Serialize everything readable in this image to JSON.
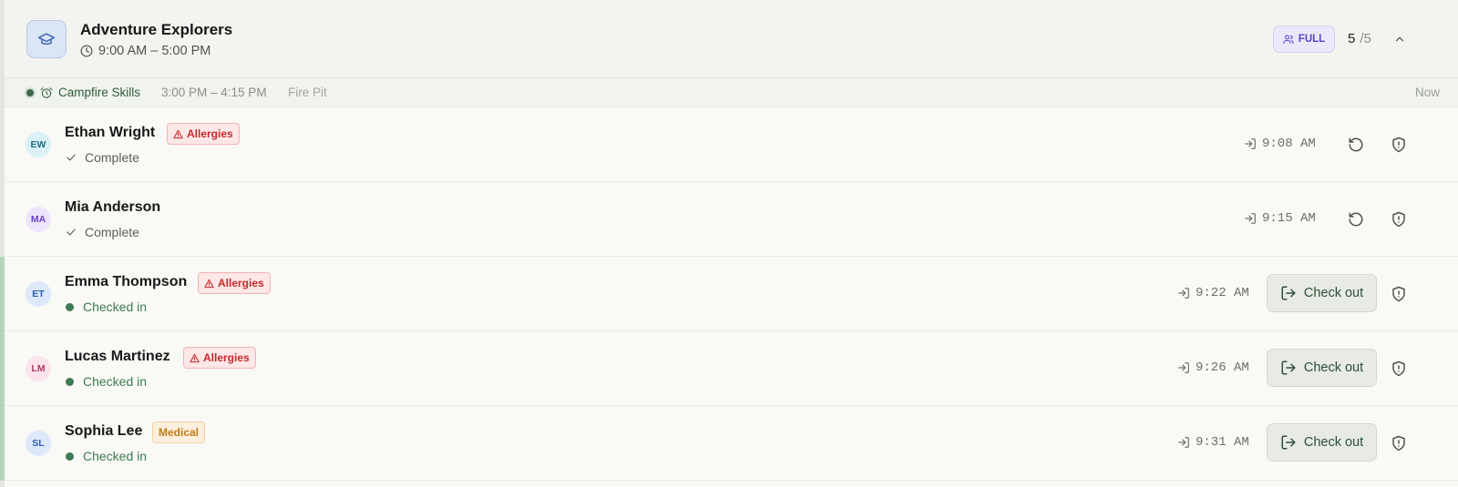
{
  "group": {
    "title": "Adventure Explorers",
    "time": "9:00 AM – 5:00 PM",
    "badge": "FULL",
    "count_current": "5",
    "count_sep": "/",
    "count_total": "5",
    "icon": "graduation-cap-icon",
    "colors": {
      "badge_bg": "#ece7fb",
      "badge_text": "#5b43c8",
      "icon_bg": "#dbe5f5"
    }
  },
  "activity": {
    "name": "Campfire Skills",
    "time": "3:00 PM – 4:15 PM",
    "location": "Fire Pit",
    "when": "Now",
    "icon": "alarm-clock-icon"
  },
  "campers": [
    {
      "initials": "EW",
      "name": "Ethan Wright",
      "tag": "Allergies",
      "tag_type": "allergy",
      "status": "Complete",
      "status_type": "complete",
      "time": "9:08 AM",
      "action": ""
    },
    {
      "initials": "MA",
      "name": "Mia Anderson",
      "tag": "",
      "tag_type": "",
      "status": "Complete",
      "status_type": "complete",
      "time": "9:15 AM",
      "action": ""
    },
    {
      "initials": "ET",
      "name": "Emma Thompson",
      "tag": "Allergies",
      "tag_type": "allergy",
      "status": "Checked in",
      "status_type": "checked",
      "time": "9:22 AM",
      "action": "Check out"
    },
    {
      "initials": "LM",
      "name": "Lucas Martinez",
      "tag": "Allergies",
      "tag_type": "allergy",
      "status": "Checked in",
      "status_type": "checked",
      "time": "9:26 AM",
      "action": "Check out"
    },
    {
      "initials": "SL",
      "name": "Sophia Lee",
      "tag": "Medical",
      "tag_type": "medical",
      "status": "Checked in",
      "status_type": "checked",
      "time": "9:31 AM",
      "action": "Check out"
    }
  ],
  "colors": {
    "allergy": "#c52a2a",
    "medical": "#c07a1c",
    "checked_in": "#3e7a52",
    "accent_green": "#2e4f3a"
  }
}
